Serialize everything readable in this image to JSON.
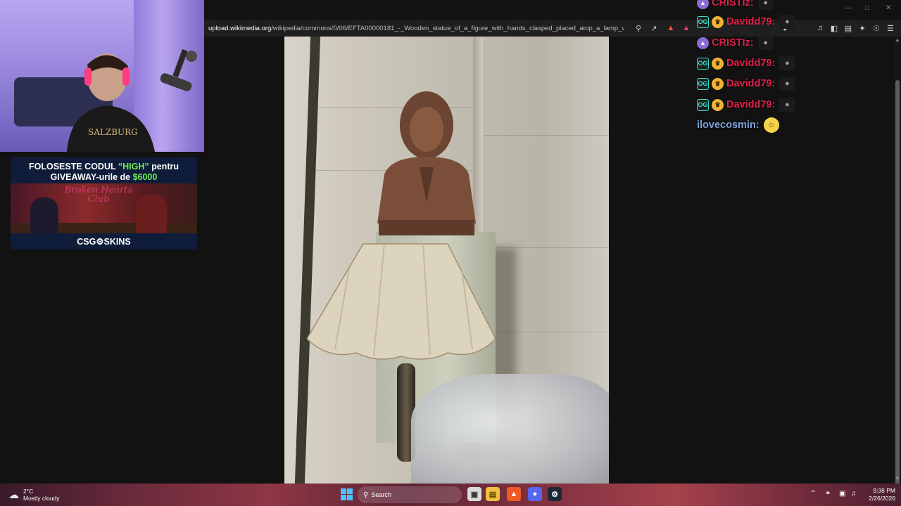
{
  "browser": {
    "url_host": "upload.wikimedia.org",
    "url_path": "/wikipedia/commons/0/06/EFTA00000181_-_Wooden_statue_of_a_figure_with_hands_clasped_placed_atop_a_lamp_with_a..."
  },
  "ad": {
    "line1_prefix": "FOLOSESTE CODUL ",
    "code": "“HIGH”",
    "line1_suffix": " pentru",
    "line2_prefix": "GIVEAWAY-urile de ",
    "amount": "$6000",
    "art_title": "Broken Hearts Club",
    "brand": "CSG⚙SKINS"
  },
  "chat": [
    {
      "user": "CRISTIz:",
      "color": "red",
      "badges": [
        "ship"
      ]
    },
    {
      "user": "Davidd79:",
      "color": "red",
      "badges": [
        "og",
        "crown"
      ]
    },
    {
      "user": "CRISTIz:",
      "color": "red",
      "badges": [
        "ship"
      ]
    },
    {
      "user": "Davidd79:",
      "color": "red",
      "badges": [
        "og",
        "crown"
      ]
    },
    {
      "user": "Davidd79:",
      "color": "red",
      "badges": [
        "og",
        "crown"
      ]
    },
    {
      "user": "Davidd79:",
      "color": "red",
      "badges": [
        "og",
        "crown"
      ]
    },
    {
      "user": "ilovecosmin:",
      "color": "blue",
      "badges": []
    }
  ],
  "badge_labels": {
    "og": "OG"
  },
  "taskbar": {
    "temperature": "2°C",
    "weather": "Mostly cloudy",
    "search": "Search",
    "time": "9:38 PM",
    "date": "2/26/2026"
  }
}
